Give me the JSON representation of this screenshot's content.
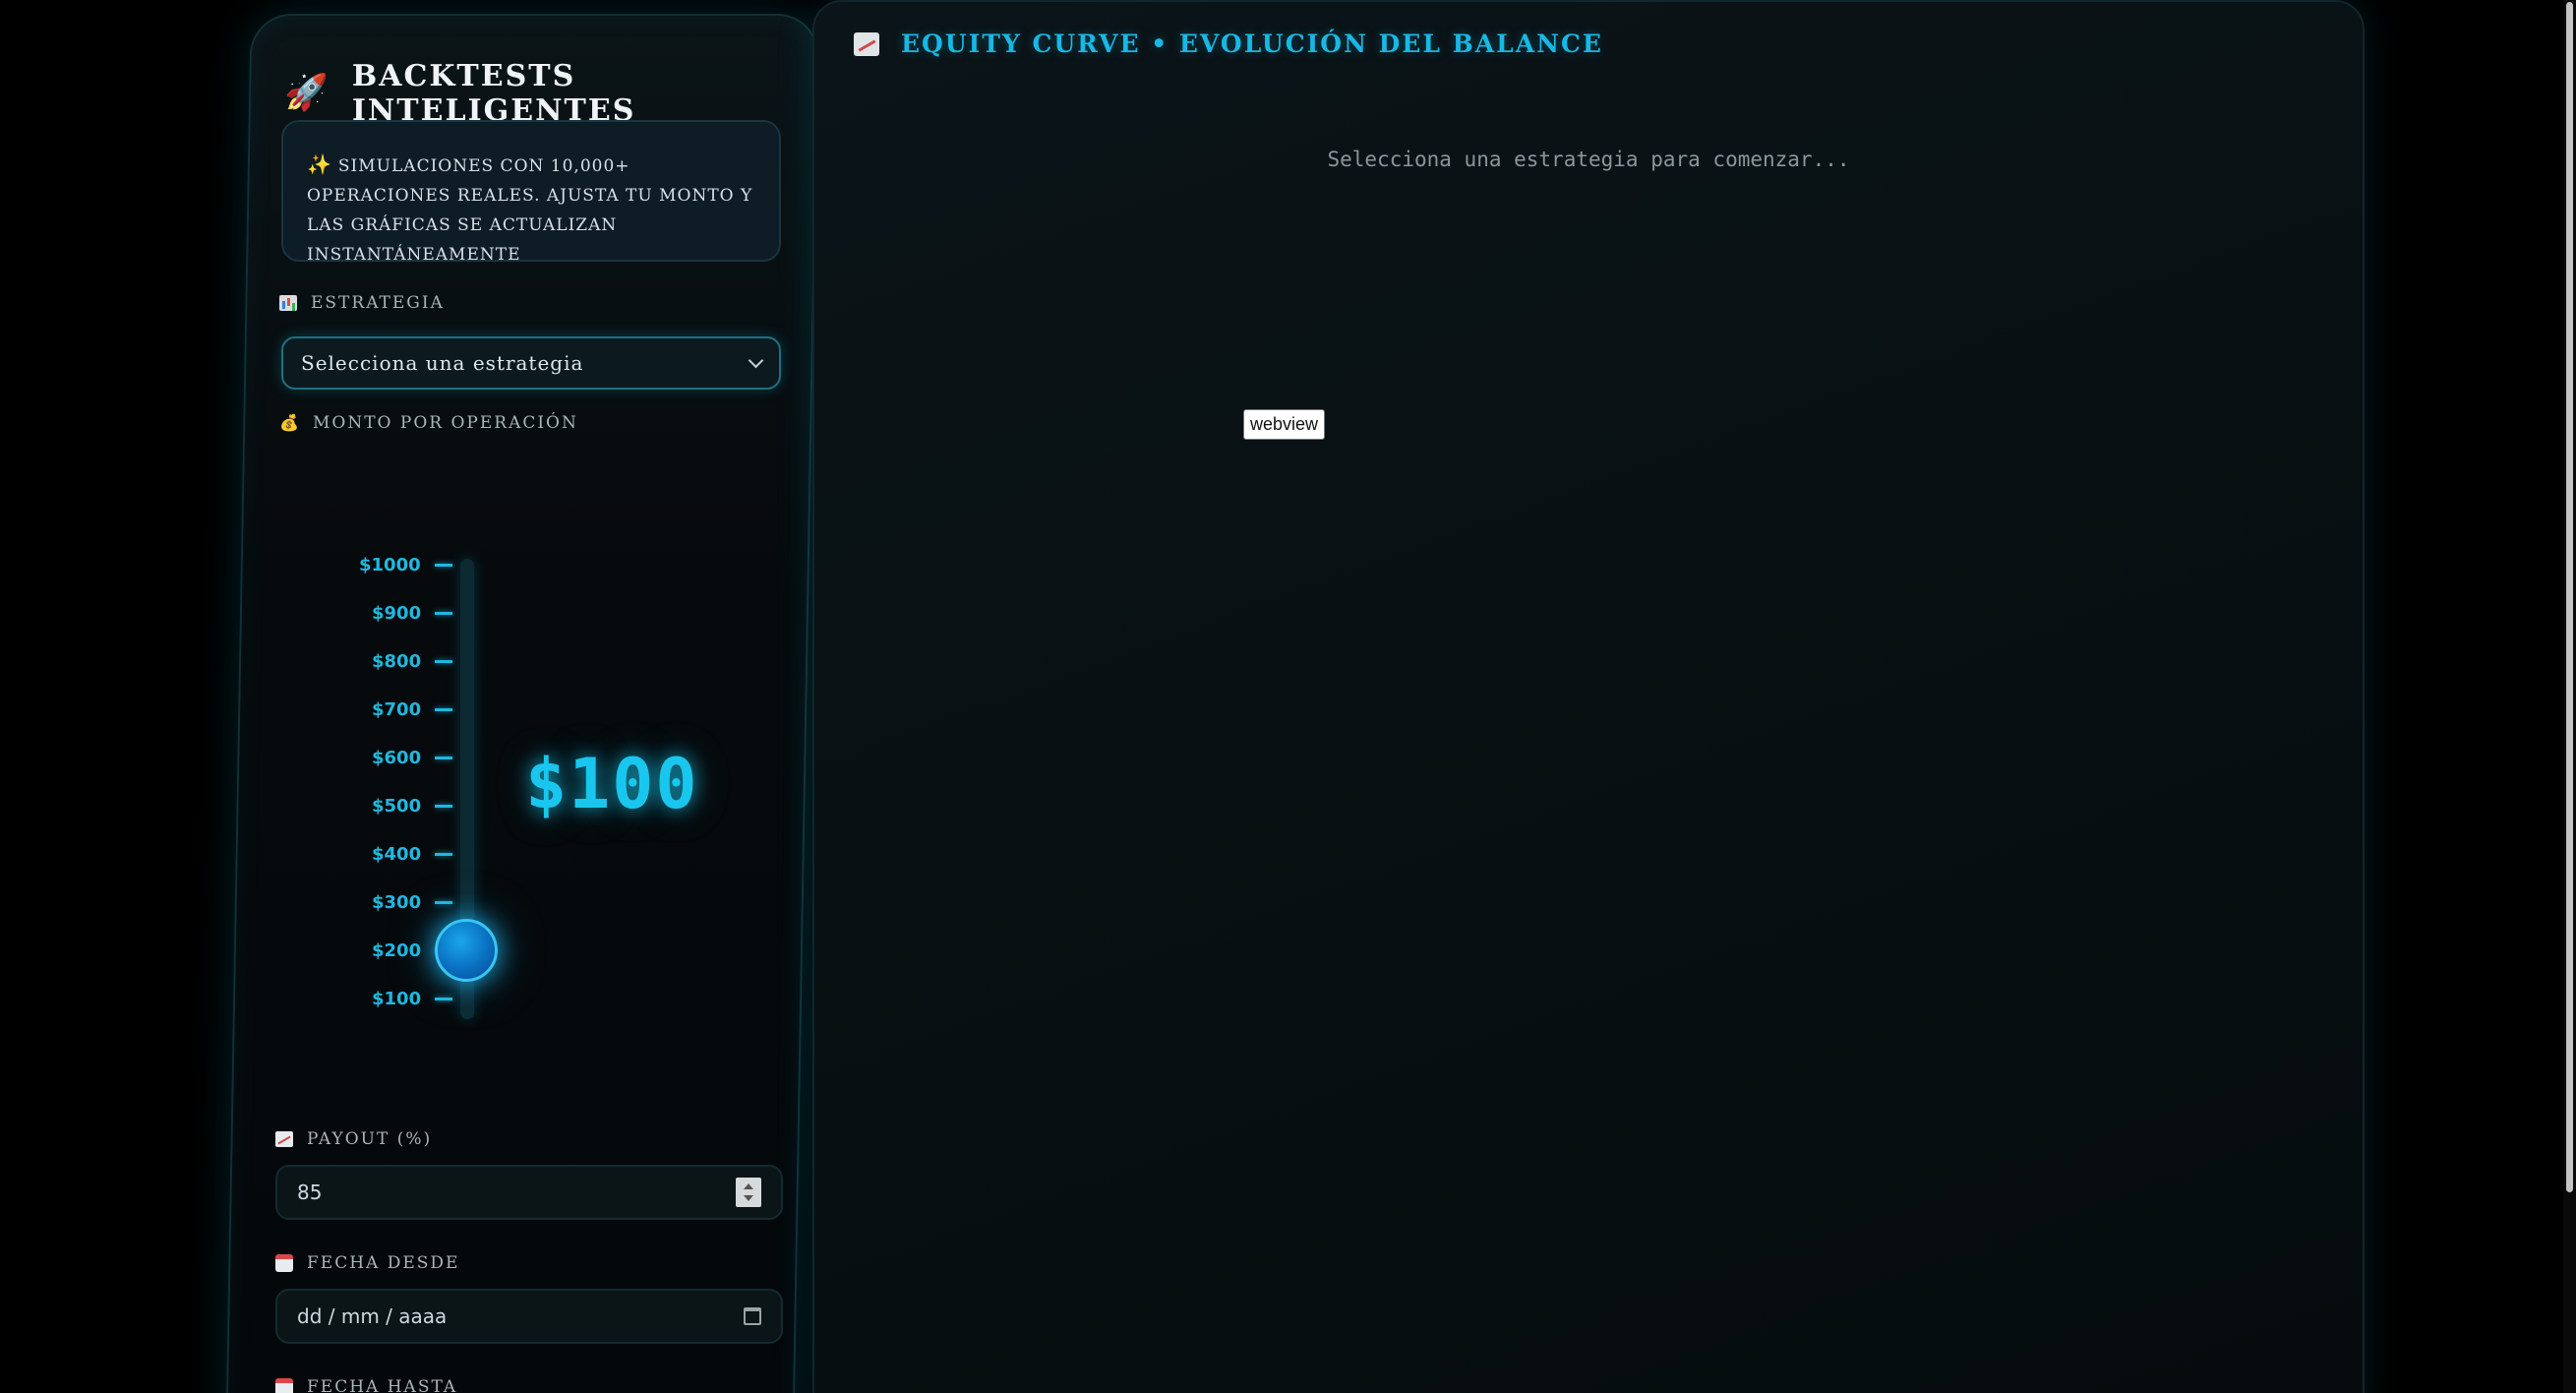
{
  "sidebar": {
    "title": "BACKTESTS INTELIGENTES",
    "title_icon": "rocket-icon",
    "info": "SIMULACIONES CON 10,000+ OPERACIONES REALES. AJUSTA TU MONTO Y LAS GRÁFICAS SE ACTUALIZAN INSTANTÁNEAMENTE",
    "info_icon": "sparkle-icon",
    "strategy": {
      "label": "ESTRATEGIA",
      "icon": "bar-chart-icon",
      "selected": "Selecciona una estrategia"
    },
    "amount": {
      "label": "MONTO POR OPERACIÓN",
      "icon": "money-bag-icon",
      "ticks": [
        "$1000",
        "$900",
        "$800",
        "$700",
        "$600",
        "$500",
        "$400",
        "$300",
        "$200",
        "$100"
      ],
      "value": "$100",
      "slider_value": 200
    },
    "payout": {
      "label": "PAYOUT (%)",
      "icon": "trend-icon",
      "value": "85"
    },
    "date_from": {
      "label": "FECHA DESDE",
      "icon": "calendar-icon",
      "placeholder": "dd / mm / aaaa"
    },
    "date_to": {
      "label": "FECHA HASTA",
      "icon": "calendar-icon"
    }
  },
  "main": {
    "title": "EQUITY CURVE • EVOLUCIÓN DEL BALANCE",
    "title_icon": "chart-icon",
    "placeholder": "Selecciona una estrategia para comenzar...",
    "webview_label": "webview"
  },
  "colors": {
    "accent": "#19c6ee",
    "background": "#000000",
    "panel": "#081013"
  }
}
